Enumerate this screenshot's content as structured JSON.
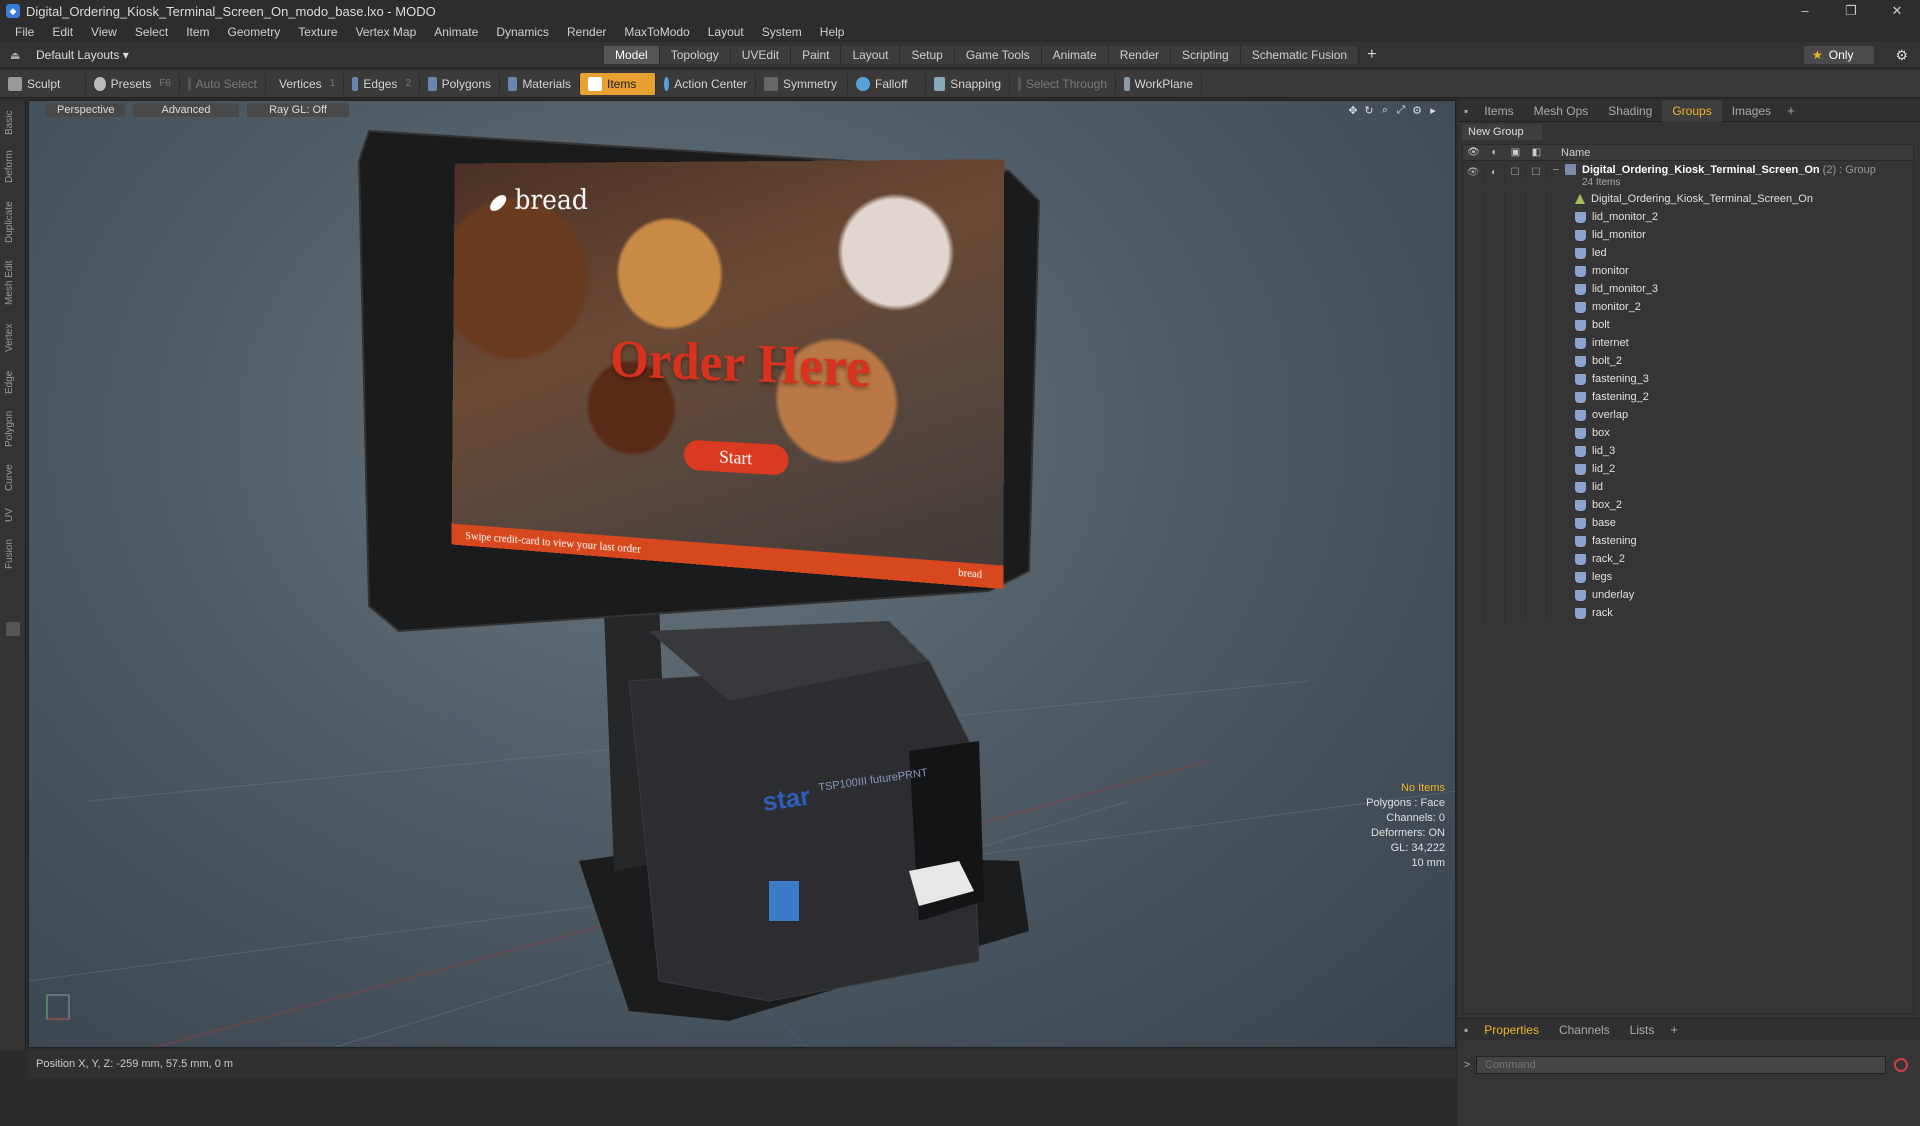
{
  "window": {
    "title": "Digital_Ordering_Kiosk_Terminal_Screen_On_modo_base.lxo - MODO",
    "minimize": "–",
    "maximize": "❐",
    "close": "✕"
  },
  "menu": [
    "File",
    "Edit",
    "View",
    "Select",
    "Item",
    "Geometry",
    "Texture",
    "Vertex Map",
    "Animate",
    "Dynamics",
    "Render",
    "MaxToModo",
    "Layout",
    "System",
    "Help"
  ],
  "layouts": {
    "label": "Default Layouts ▾"
  },
  "tabs": [
    "Model",
    "Topology",
    "UVEdit",
    "Paint",
    "Layout",
    "Setup",
    "Game Tools",
    "Animate",
    "Render",
    "Scripting",
    "Schematic Fusion"
  ],
  "active_tab": "Model",
  "only_label": "Only",
  "toolbar": {
    "sculpt": "Sculpt",
    "presets": "Presets",
    "presets_key": "F6",
    "auto_select": "Auto Select",
    "vertices": "Vertices",
    "vertices_key": "1",
    "edges": "Edges",
    "edges_key": "2",
    "polygons": "Polygons",
    "materials": "Materials",
    "items": "Items",
    "action_center": "Action Center",
    "symmetry": "Symmetry",
    "falloff": "Falloff",
    "snapping": "Snapping",
    "select_through": "Select Through",
    "workplane": "WorkPlane"
  },
  "left_strip": [
    "Basic",
    "Deform",
    "Duplicate",
    "Mesh Edit",
    "Vertex",
    "Edge",
    "Polygon",
    "Curve",
    "UV",
    "Fusion"
  ],
  "viewport": {
    "perspective": "Perspective",
    "advanced": "Advanced",
    "raygl": "Ray GL: Off",
    "screen": {
      "brand": "bread",
      "headline": "Order Here",
      "button": "Start",
      "footer": "Swipe credit-card to view your last order",
      "footer_brand": "bread"
    },
    "printer_brand": "star",
    "printer_model": "TSP100III futurePRNT",
    "hud": {
      "no_items": "No Items",
      "polygons": "Polygons : Face",
      "channels": "Channels: 0",
      "deformers": "Deformers: ON",
      "gl": "GL: 34,222",
      "unit": "10 mm"
    }
  },
  "status": {
    "position": "Position X, Y, Z:  -259 mm, 57.5 mm, 0 m"
  },
  "right_tabs": [
    "Items",
    "Mesh Ops",
    "Shading",
    "Groups",
    "Images"
  ],
  "right_active": "Groups",
  "groups": {
    "new_group": "New Group",
    "col_name": "Name",
    "root": {
      "name": "Digital_Ordering_Kiosk_Terminal_Screen_On",
      "suffix": "(2) : Group",
      "count": "24 Items"
    },
    "items": [
      "Digital_Ordering_Kiosk_Terminal_Screen_On",
      "lid_monitor_2",
      "lid_monitor",
      "led",
      "monitor",
      "lid_monitor_3",
      "monitor_2",
      "bolt",
      "internet",
      "bolt_2",
      "fastening_3",
      "fastening_2",
      "overlap",
      "box",
      "lid_3",
      "lid_2",
      "lid",
      "box_2",
      "base",
      "fastening",
      "rack_2",
      "legs",
      "underlay",
      "rack"
    ]
  },
  "bottom_tabs": [
    "Properties",
    "Channels",
    "Lists"
  ],
  "bottom_active": "Properties",
  "command": {
    "placeholder": "Command"
  }
}
